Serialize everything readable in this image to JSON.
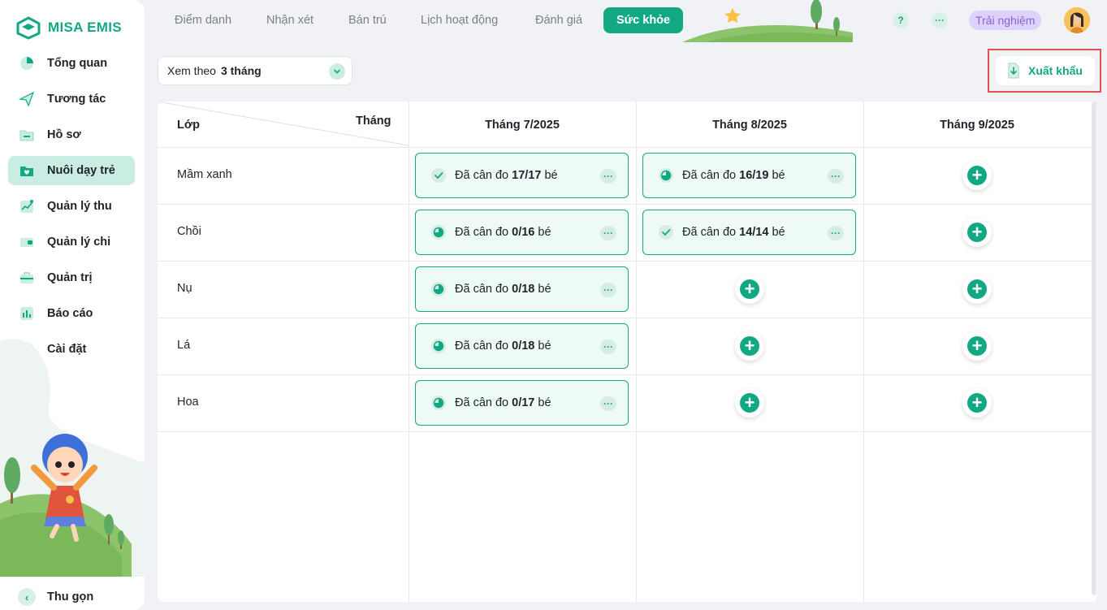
{
  "brand": {
    "name": "MISA EMIS",
    "accent": "#13a884"
  },
  "sidebar": {
    "items": [
      {
        "label": "Tổng quan",
        "icon": "pie-chart-icon",
        "active": false
      },
      {
        "label": "Tương tác",
        "icon": "paper-plane-icon",
        "active": false
      },
      {
        "label": "Hồ sơ",
        "icon": "folder-icon",
        "active": false
      },
      {
        "label": "Nuôi dạy trẻ",
        "icon": "heart-folder-icon",
        "active": true
      },
      {
        "label": "Quản lý thu",
        "icon": "trend-up-icon",
        "active": false
      },
      {
        "label": "Quản lý chi",
        "icon": "wallet-icon",
        "active": false
      },
      {
        "label": "Quản trị",
        "icon": "briefcase-icon",
        "active": false
      },
      {
        "label": "Báo cáo",
        "icon": "bar-chart-icon",
        "active": false
      },
      {
        "label": "Cài đặt",
        "icon": "gear-icon",
        "active": false
      }
    ],
    "collapse_label": "Thu gọn"
  },
  "topbar": {
    "tabs": [
      "Điểm danh",
      "Nhận xét",
      "Bán trú",
      "Lịch hoạt động",
      "Đánh giá"
    ],
    "active_tab": "Sức khỏe",
    "help": "?",
    "more": "···",
    "trial": "Trải nghiệm"
  },
  "filter": {
    "prefix": "Xem theo",
    "value": "3 tháng"
  },
  "export_label": "Xuất khẩu",
  "table": {
    "corner_class": "Lớp",
    "corner_month": "Tháng",
    "months": [
      "Tháng 7/2025",
      "Tháng 8/2025",
      "Tháng 9/2025"
    ],
    "cell_prefix": "Đã cân đo",
    "cell_suffix": "bé",
    "more": "···",
    "add": "+",
    "rows": [
      {
        "class": "Mầm xanh",
        "cells": [
          {
            "done": true,
            "count": "17/17"
          },
          {
            "done": false,
            "count": "16/19"
          },
          null
        ]
      },
      {
        "class": "Chồi",
        "cells": [
          {
            "done": false,
            "count": "0/16"
          },
          {
            "done": true,
            "count": "14/14"
          },
          null
        ]
      },
      {
        "class": "Nụ",
        "cells": [
          {
            "done": false,
            "count": "0/18"
          },
          null,
          null
        ]
      },
      {
        "class": "Lá",
        "cells": [
          {
            "done": false,
            "count": "0/18"
          },
          null,
          null
        ]
      },
      {
        "class": "Hoa",
        "cells": [
          {
            "done": false,
            "count": "0/17"
          },
          null,
          null
        ]
      }
    ]
  }
}
